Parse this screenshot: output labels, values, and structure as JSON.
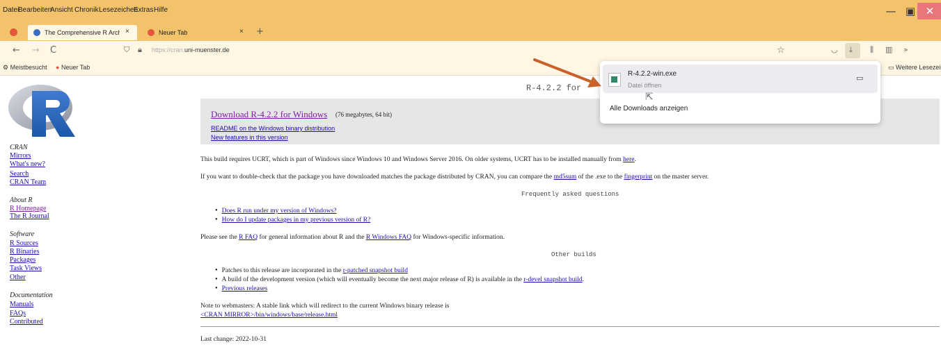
{
  "menu": [
    "Datei",
    "Bearbeiten",
    "Ansicht",
    "Chronik",
    "Lesezeichen",
    "Extras",
    "Hilfe"
  ],
  "tabs": [
    {
      "label": "The Comprehensive R Archive N",
      "close": "×"
    },
    {
      "label": "Neuer Tab",
      "close": "×"
    }
  ],
  "tabs_new": "+",
  "nav": {
    "back": "←",
    "forward": "→",
    "reload": "C",
    "url_prefix": "https://cran.",
    "url_host": "uni-muenster.de",
    "star": "☆",
    "overflow": "»"
  },
  "bookmarks": {
    "most_visited": "Meistbesucht",
    "new_tab": "Neuer Tab",
    "more": "Weitere Lesezeichen"
  },
  "sidebar": {
    "cran_heading": "CRAN",
    "cran_links": [
      "Mirrors",
      "What's new?",
      "Search",
      "CRAN Team"
    ],
    "about_heading": "About R",
    "about_links": [
      "R Homepage",
      "The R Journal"
    ],
    "software_heading": "Software",
    "software_links": [
      "R Sources",
      "R Binaries",
      "Packages",
      "Task Views",
      "Other"
    ],
    "doc_heading": "Documentation",
    "doc_links": [
      "Manuals",
      "FAQs",
      "Contributed"
    ]
  },
  "main": {
    "heading": "R-4.2.2 for",
    "download_link": "Download R-4.2.2 for Windows",
    "download_size": "(76 megabytes, 64 bit)",
    "readme_link": "README on the Windows binary distribution",
    "newfeatures_link": "New features in this version",
    "ucrt_text": "This build requires UCRT, which is part of Windows since Windows 10 and Windows Server 2016. On older systems, UCRT has to be installed manually from",
    "ucrt_link": "here",
    "check_text_1": "If you want to double-check that the package you have downloaded matches the package distributed by CRAN, you can compare the",
    "md5_link": "md5sum",
    "check_text_2": "of the .exe to the",
    "fingerprint_link": "fingerprint",
    "check_text_3": "on the master server.",
    "faq_heading": "Frequently asked questions",
    "faq_items": [
      "Does R run under my version of Windows?",
      "How do I update packages in my previous version of R?"
    ],
    "see_text_1": "Please see the",
    "rfaq_link": "R FAQ",
    "see_text_2": "for general information about R and the",
    "rwinfaq_link": "R Windows FAQ",
    "see_text_3": "for Windows-specific information.",
    "other_heading": "Other builds",
    "patches_text": "Patches to this release are incorporated in the",
    "patches_link": "r-patched snapshot build",
    "devel_text": "A build of the development version (which will eventually become the next major release of R) is available in the",
    "devel_link": "r-devel snapshot build",
    "previous_link": "Previous releases",
    "webmaster_text": "Note to webmasters: A stable link which will redirect to the current Windows binary release is",
    "release_link": "<CRAN MIRROR>/bin/windows/base/release.html",
    "last_change": "Last change: 2022-10-31"
  },
  "downloads": {
    "filename": "R-4.2.2-win.exe",
    "status": "Datei öffnen",
    "show_all": "Alle Downloads anzeigen"
  },
  "colors": {
    "title_bar": "#f2c36b",
    "toolbar": "#fff7e4",
    "annotation_arrow": "#c8622a"
  }
}
